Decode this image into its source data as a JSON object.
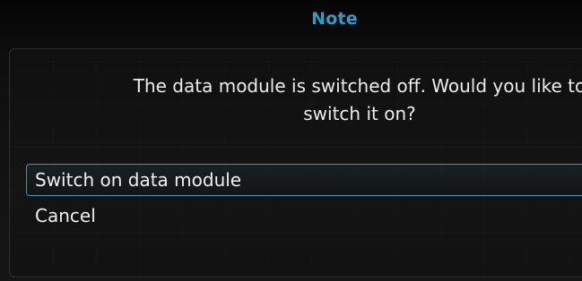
{
  "dialog": {
    "title": "Note",
    "message": "The data module is switched off. Would you like to switch it on?",
    "options": [
      {
        "label": "Switch on data module",
        "selected": true
      },
      {
        "label": "Cancel",
        "selected": false
      }
    ]
  },
  "colors": {
    "accent": "#3a98c4",
    "text": "#f0f0f0",
    "background": "#111111"
  }
}
